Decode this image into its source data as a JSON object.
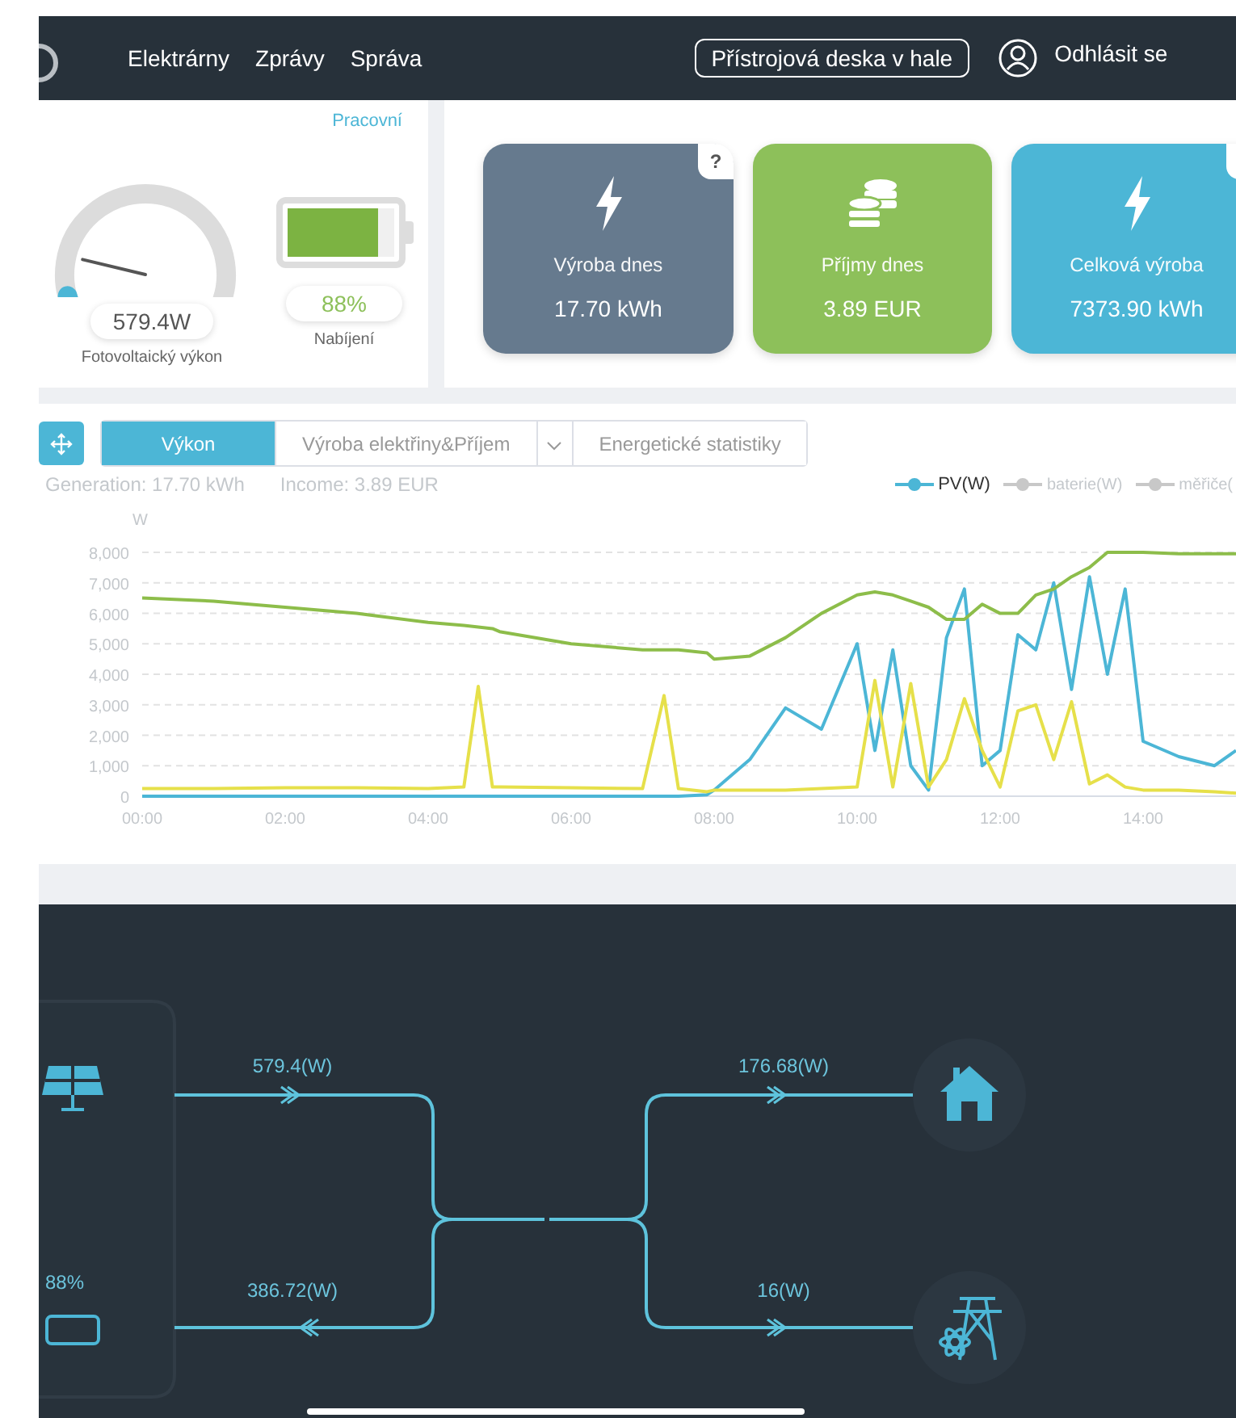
{
  "nav": {
    "items": [
      {
        "label": "Elektrárny"
      },
      {
        "label": "Zprávy"
      },
      {
        "label": "Správa"
      }
    ],
    "dashboard_button": "Přístrojová deska v hale",
    "logout": "Odhlásit se"
  },
  "overview": {
    "status": "Pracovní",
    "gauge": {
      "level": 0.07,
      "value": "579.4W",
      "label": "Fotovoltaický výkon"
    },
    "battery": {
      "level": 0.85,
      "value": "88%",
      "label": "Nabíjení"
    }
  },
  "stat_cards": [
    {
      "kind": "bolt",
      "color": "#667a8e",
      "label": "Výroba dnes",
      "value": "17.70 kWh",
      "has_badge": true,
      "badge": "?"
    },
    {
      "kind": "coins",
      "color": "#8dc05a",
      "label": "Příjmy dnes",
      "value": "3.89 EUR"
    },
    {
      "kind": "bolt",
      "color": "#4cb6d6",
      "label": "Celková výroba",
      "value": "7373.90 kWh",
      "has_badge": true
    }
  ],
  "chart_panel": {
    "tabs": [
      {
        "label": "Výkon",
        "selected": true
      },
      {
        "label": "Výroba elektřiny&Příjem",
        "selected": false,
        "dropdown": true
      },
      {
        "label": "Energetické statistiky",
        "selected": false
      }
    ],
    "summary": [
      "Generation: 17.70 kWh",
      "Income: 3.89 EUR"
    ],
    "legend": [
      {
        "label": "PV(W)",
        "selected": true,
        "color": "#4cb6d6"
      },
      {
        "label": "baterie(W)",
        "selected": false,
        "color": "#c8c8c8"
      },
      {
        "label": "měřiče(",
        "selected": false,
        "color": "#c8c8c8"
      }
    ],
    "chart_data": {
      "type": "line",
      "grid": true,
      "ylabel": "W",
      "xlim": [
        0,
        15.3
      ],
      "ylim": [
        0,
        8000
      ],
      "xticks": [
        {
          "value": 0,
          "label": "00:00"
        },
        {
          "value": 2,
          "label": "02:00"
        },
        {
          "value": 4,
          "label": "04:00"
        },
        {
          "value": 6,
          "label": "06:00"
        },
        {
          "value": 8,
          "label": "08:00"
        },
        {
          "value": 10,
          "label": "10:00"
        },
        {
          "value": 12,
          "label": "12:00"
        },
        {
          "value": 14,
          "label": "14:00"
        }
      ],
      "yticks": [
        {
          "value": 0,
          "label": "0"
        },
        {
          "value": 1000,
          "label": "1,000"
        },
        {
          "value": 2000,
          "label": "2,000"
        },
        {
          "value": 3000,
          "label": "3,000"
        },
        {
          "value": 4000,
          "label": "4,000"
        },
        {
          "value": 5000,
          "label": "5,000"
        },
        {
          "value": 6000,
          "label": "6,000"
        },
        {
          "value": 7000,
          "label": "7,000"
        },
        {
          "value": 8000,
          "label": "8,000"
        }
      ],
      "x": [
        0,
        1,
        2,
        3,
        4,
        4.5,
        4.7,
        4.9,
        5,
        6,
        7,
        7.3,
        7.5,
        7.9,
        8,
        8.5,
        9,
        9.5,
        10,
        10.25,
        10.5,
        10.75,
        11,
        11.25,
        11.5,
        11.75,
        12,
        12.25,
        12.5,
        12.75,
        13,
        13.25,
        13.5,
        13.75,
        14,
        14.5,
        15,
        15.3
      ],
      "series": [
        {
          "color": "#4cb6d6",
          "values": [
            0,
            0,
            0,
            0,
            0,
            0,
            0,
            0,
            0,
            0,
            0,
            0,
            0,
            50,
            200,
            1200,
            2900,
            2200,
            5000,
            1500,
            4800,
            1000,
            200,
            5200,
            6800,
            1000,
            1500,
            5300,
            4800,
            7000,
            3500,
            7200,
            4000,
            6800,
            1800,
            1300,
            1000,
            1500
          ]
        },
        {
          "color": "#8dbd4a",
          "values": [
            6500,
            6400,
            6200,
            6000,
            5700,
            5600,
            5550,
            5500,
            5400,
            5000,
            4800,
            4800,
            4800,
            4700,
            4500,
            4600,
            5200,
            6000,
            6600,
            6700,
            6600,
            6400,
            6200,
            5800,
            5800,
            6300,
            6000,
            6000,
            6600,
            6800,
            7200,
            7500,
            8000,
            8000,
            8000,
            7950,
            7950,
            7950
          ]
        },
        {
          "color": "#e6e04a",
          "values": [
            250,
            250,
            280,
            280,
            250,
            300,
            3600,
            300,
            300,
            280,
            250,
            3300,
            250,
            150,
            200,
            200,
            200,
            250,
            300,
            3800,
            300,
            3700,
            300,
            1200,
            3200,
            1500,
            300,
            2800,
            3000,
            1200,
            3100,
            400,
            700,
            300,
            200,
            200,
            150,
            100
          ]
        }
      ]
    }
  },
  "flow": {
    "battery_percent": "88%",
    "flows": [
      {
        "label": "579.4(W)",
        "kind": "forward"
      },
      {
        "label": "386.72(W)",
        "kind": "backward"
      },
      {
        "label": "176.68(W)",
        "kind": "forward"
      },
      {
        "label": "16(W)",
        "kind": "forward"
      }
    ]
  }
}
